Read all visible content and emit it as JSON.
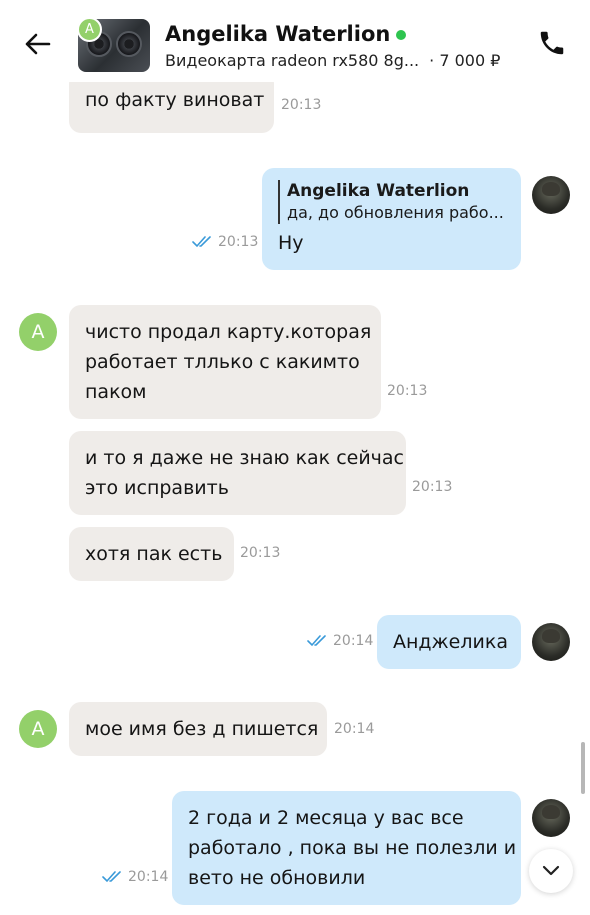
{
  "header": {
    "contact_name": "Angelika Waterlion",
    "contact_initial": "A",
    "item_title": "Видеокарта radeon rx580 8g...",
    "item_price": "· 7 000 ₽",
    "online": true,
    "colors": {
      "online": "#2ec44f",
      "avatar": "#93d06a"
    },
    "icons": [
      "back-arrow-icon",
      "phone-icon"
    ]
  },
  "messages": [
    {
      "id": "m1",
      "direction": "in",
      "lines": [
        "по факту виноват"
      ],
      "time": "20:13"
    },
    {
      "id": "m2",
      "direction": "out",
      "reply_to_name": "Angelika Waterlion",
      "reply_to_text": "да, до обновления рабо...",
      "lines": [
        "Ну"
      ],
      "time": "20:13",
      "read": true
    },
    {
      "id": "m3",
      "direction": "in",
      "avatar": "A",
      "lines": [
        "чисто продал карту.которая",
        "работает тллько с какимто",
        "паком"
      ],
      "time": "20:13"
    },
    {
      "id": "m4",
      "direction": "in",
      "lines": [
        "и то я даже не знаю как сейчас",
        "это исправить"
      ],
      "time": "20:13"
    },
    {
      "id": "m5",
      "direction": "in",
      "lines": [
        "хотя пак есть"
      ],
      "time": "20:13"
    },
    {
      "id": "m6",
      "direction": "out",
      "lines": [
        "Анджелика"
      ],
      "time": "20:14",
      "read": true
    },
    {
      "id": "m7",
      "direction": "in",
      "avatar": "A",
      "lines": [
        "мое имя без д пишется"
      ],
      "time": "20:14"
    },
    {
      "id": "m8",
      "direction": "out",
      "lines": [
        "2 года и 2 месяца у вас все",
        "работало , пока вы не полезли и",
        "вето не обновили"
      ],
      "time": "20:14",
      "read": true
    }
  ],
  "colors": {
    "incoming_bubble": "#efece9",
    "outgoing_bubble": "#cfe9fb",
    "read_ticks": "#3a9ad9"
  }
}
